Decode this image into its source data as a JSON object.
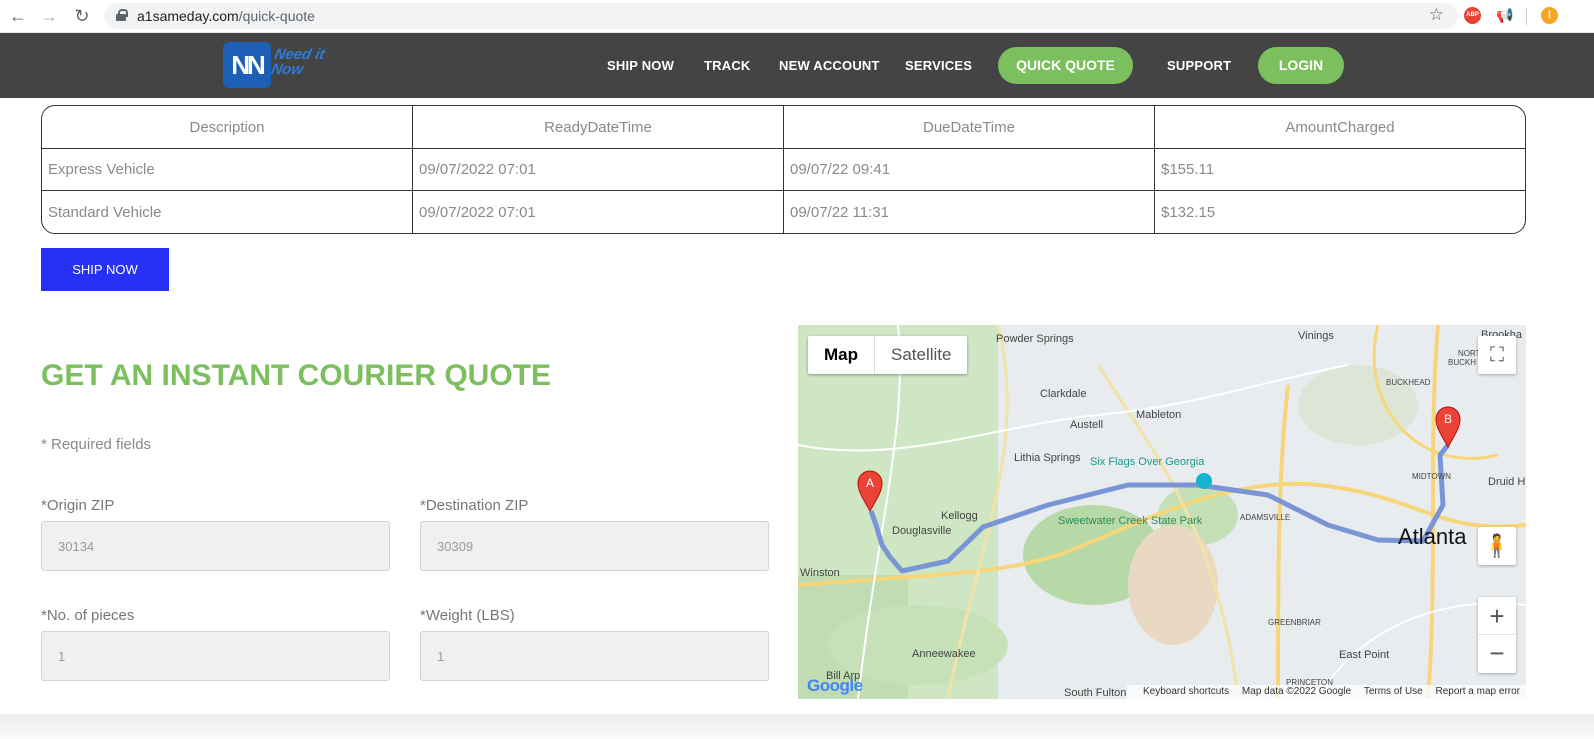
{
  "browser": {
    "url_domain": "a1sameday.com",
    "url_path": "/quick-quote"
  },
  "header": {
    "logo_text": "NN",
    "logo_script": "Need it Now",
    "nav": [
      "SHIP NOW",
      "TRACK",
      "NEW ACCOUNT",
      "SERVICES",
      "QUICK QUOTE",
      "SUPPORT",
      "LOGIN"
    ],
    "accent": "#7bbf5e",
    "background": "#444444"
  },
  "results": {
    "columns": [
      "Description",
      "ReadyDateTime",
      "DueDateTime",
      "AmountCharged"
    ],
    "rows": [
      [
        "Express Vehicle",
        "09/07/2022 07:01",
        "09/07/22 09:41",
        "$155.11"
      ],
      [
        "Standard Vehicle",
        "09/07/2022 07:01",
        "09/07/22 11:31",
        "$132.15"
      ]
    ],
    "ship_button": "SHIP NOW"
  },
  "form": {
    "title": "GET AN INSTANT COURIER QUOTE",
    "required_note": "* Required fields",
    "origin_label": "*Origin ZIP",
    "origin_value": "30134",
    "destination_label": "*Destination ZIP",
    "destination_value": "30309",
    "pieces_label": "*No. of pieces",
    "pieces_value": "1",
    "weight_label": "*Weight (LBS)",
    "weight_value": "1"
  },
  "map": {
    "type_map": "Map",
    "type_satellite": "Satellite",
    "marker_a": "A",
    "marker_b": "B",
    "labels": [
      "Powder Springs",
      "Clarkdale",
      "Mableton",
      "Austell",
      "Vinings",
      "Lithia Springs",
      "Six Flags Over Georgia",
      "Kellogg",
      "Douglasville",
      "Sweetwater Creek State Park",
      "ADAMSVILLE",
      "Atlanta",
      "Winston",
      "Anneewakee",
      "Bill Arp",
      "South Fulton",
      "GREENBRIAR",
      "East Point",
      "PRINCETON",
      "BUCKHEAD",
      "MIDTOWN",
      "Druid H",
      "Brookha",
      "NORTH",
      "BUCKH"
    ],
    "footer": [
      "Keyboard shortcuts",
      "Map data ©2022 Google",
      "Terms of Use",
      "Report a map error"
    ],
    "google_logo": "Google"
  }
}
